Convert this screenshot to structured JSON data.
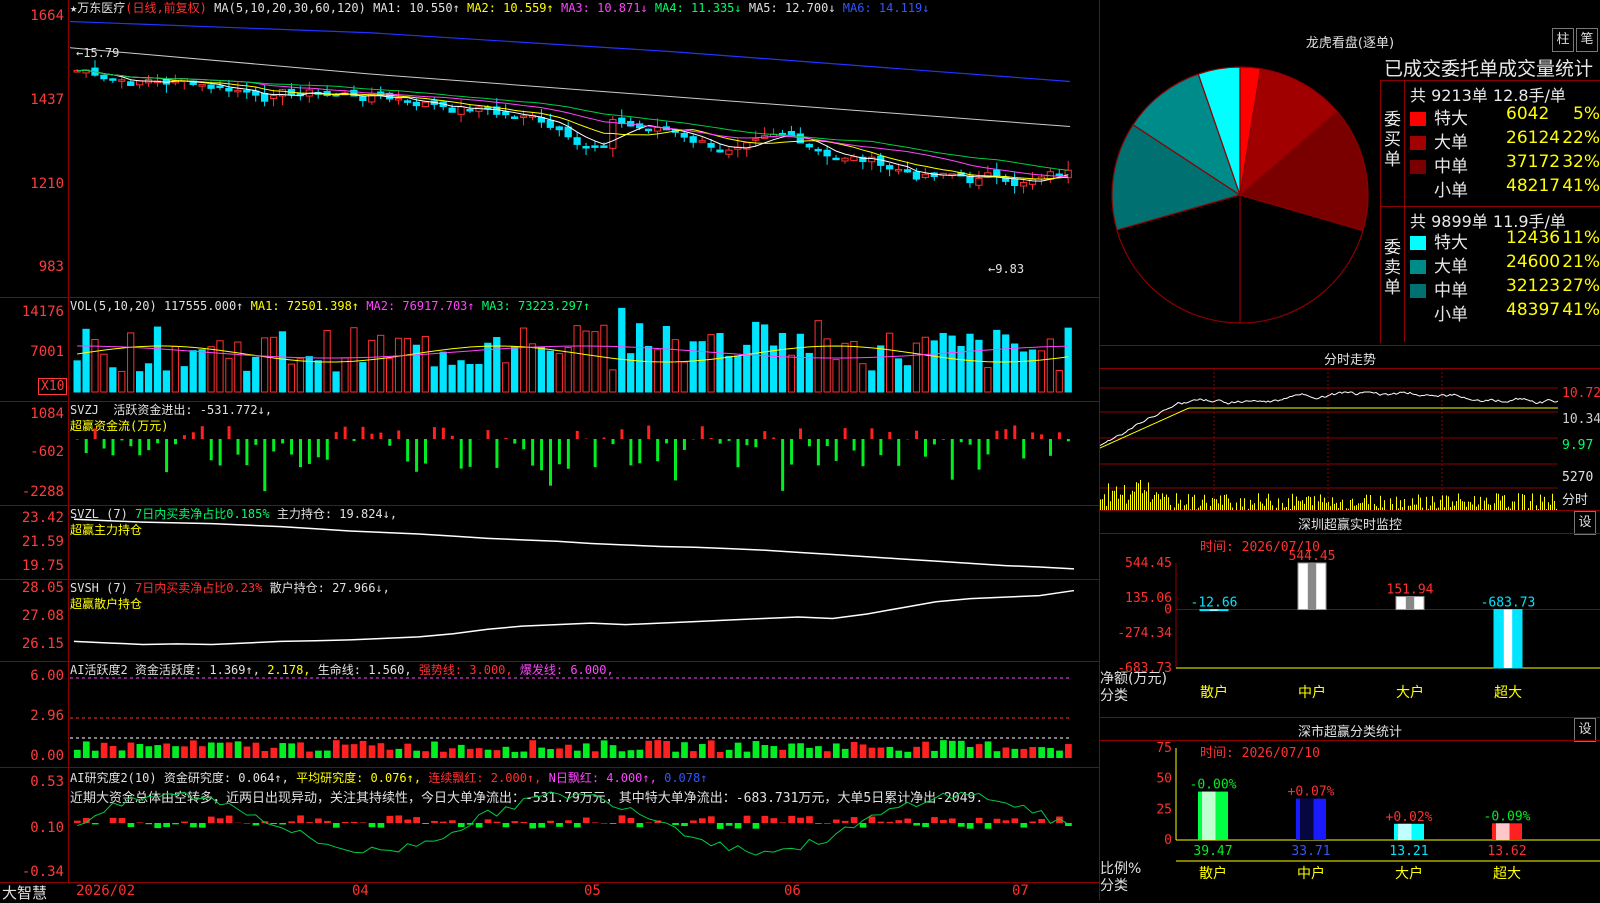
{
  "stock": {
    "name": "★万东医疗",
    "period": "(日线,前复权)"
  },
  "ma_legend": {
    "label": "MA(5,10,20,30,60,120)",
    "ma1": "MA1: 10.550↑",
    "ma2": "MA2: 10.559↑",
    "ma3": "MA3: 10.871↓",
    "ma4": "MA4: 11.335↓",
    "ma5": "MA5: 12.700↓",
    "ma6": "MA6: 14.119↓"
  },
  "price_axis": [
    "1664",
    "1437",
    "1210",
    "983"
  ],
  "price_annotations": {
    "high": "15.79",
    "low": "9.83"
  },
  "vol_panel": {
    "label": "VOL(5,10,20)",
    "value": "117555.000↑",
    "ma1": "MA1: 72501.398↑",
    "ma2": "MA2: 76917.703↑",
    "ma3": "MA3: 73223.297↑",
    "axis": [
      "14176",
      "7001"
    ],
    "unit": "X10"
  },
  "svzj_panel": {
    "label": "SVZJ",
    "line1": "活跃资金进出: -531.772↓,",
    "line2": "超赢资金流(万元)",
    "axis": [
      "1084",
      "-602",
      "-2288"
    ]
  },
  "svzl_panel": {
    "label": "SVZL (7)",
    "text_a": "7日内买卖净占比0.185%",
    "text_b": "主力持仓: 19.824↓,",
    "line2": "超赢主力持仓",
    "axis": [
      "23.42",
      "21.59",
      "19.75"
    ]
  },
  "svsh_panel": {
    "label": "SVSH (7)",
    "text_a": "7日内买卖净占比0.23%",
    "text_b": "散户持仓: 27.966↓,",
    "line2": "超赢散户持仓",
    "axis": [
      "28.05",
      "27.08",
      "26.15"
    ]
  },
  "ai_active": {
    "label": "AI活跃度2",
    "t1": "资金活跃度: 1.369↑,",
    "t2": "2.178,",
    "t3": "生命线: 1.560,",
    "t4": "强势线: 3.000,",
    "t5": "爆发线: 6.000,",
    "axis": [
      "6.00",
      "2.96",
      "0.00"
    ]
  },
  "ai_research": {
    "label": "AI研究度2(10)",
    "t1": "资金研究度: 0.064↑,",
    "t2": "平均研究度: 0.076↑,",
    "t3": "连续飘红: 2.000↑,",
    "t4": "N日飘红: 4.000↑,",
    "t5": "0.078↑",
    "comment": "近期大资金总体由空转多，近两日出现异动，关注其持续性，今日大单净流出：-531.79万元，其中特大单净流出：-683.731万元，大单5日累计净出-2049.",
    "axis": [
      "0.53",
      "0.10",
      "-0.34"
    ]
  },
  "time_axis": [
    "2026/02",
    "04",
    "05",
    "06",
    "07"
  ],
  "brand": "大智慧",
  "dragon": {
    "title": "龙虎看盘(逐单)",
    "btn1": "柱",
    "btn2": "笔",
    "stats_title": "已成交委托单成交量统计",
    "buy_header": "共 9213单 12.8手/单",
    "buy_side": "委买单",
    "buy_rows": [
      {
        "name": "特大",
        "vol": "6042",
        "pct": "5%",
        "color": "#ff0000"
      },
      {
        "name": "大单",
        "vol": "26124",
        "pct": "22%",
        "color": "#a00000"
      },
      {
        "name": "中单",
        "vol": "37172",
        "pct": "32%",
        "color": "#7a0000"
      },
      {
        "name": "小单",
        "vol": "48217",
        "pct": "41%",
        "color": "#000000"
      }
    ],
    "sell_header": "共 9899单 11.9手/单",
    "sell_side": "委卖单",
    "sell_rows": [
      {
        "name": "特大",
        "vol": "12436",
        "pct": "11%",
        "color": "#00ffff"
      },
      {
        "name": "大单",
        "vol": "24600",
        "pct": "21%",
        "color": "#008b8b"
      },
      {
        "name": "中单",
        "vol": "32123",
        "pct": "27%",
        "color": "#007070"
      },
      {
        "name": "小单",
        "vol": "48397",
        "pct": "41%",
        "color": "#000000"
      }
    ]
  },
  "intraday": {
    "title": "分时走势",
    "axis": [
      "10.72",
      "10.34",
      "9.97",
      "5270",
      "分时"
    ]
  },
  "monitor": {
    "title": "深圳超赢实时监控",
    "btn": "设",
    "time": "时间: 2026/07/10",
    "axis": [
      "544.45",
      "135.06",
      "0",
      "-274.34",
      "-683.73"
    ],
    "ylabel1": "净额(万元)",
    "ylabel2": "分类"
  },
  "classify": {
    "title": "深市超赢分类统计",
    "btn": "设",
    "time": "时间: 2026/07/10",
    "axis": [
      "75",
      "50",
      "25",
      "0"
    ],
    "ylabel1": "比例%",
    "ylabel2": "分类"
  },
  "chart_data": [
    {
      "type": "pie",
      "title": "龙虎看盘(逐单)",
      "categories": [
        "委买单 特大",
        "委买单 大单",
        "委买单 中单",
        "委买单 小单",
        "委卖单 小单",
        "委卖单 中单",
        "委卖单 大单",
        "委卖单 特大"
      ],
      "values": [
        6042,
        26124,
        37172,
        48217,
        48397,
        32123,
        24600,
        12436
      ],
      "colors": [
        "#ff0000",
        "#a00000",
        "#7a0000",
        "#000000",
        "#000000",
        "#007070",
        "#008b8b",
        "#00ffff"
      ]
    },
    {
      "type": "bar",
      "title": "深圳超赢实时监控",
      "categories": [
        "散户",
        "中户",
        "大户",
        "超大"
      ],
      "values": [
        -12.66,
        544.45,
        151.94,
        -683.73
      ],
      "value_labels": [
        "-12.66",
        "544.45",
        "151.94",
        "-683.73"
      ],
      "ylabel": "净额(万元)",
      "xlabel": "分类",
      "ylim": [
        -683.73,
        544.45
      ]
    },
    {
      "type": "bar",
      "title": "深市超赢分类统计",
      "categories": [
        "散户",
        "中户",
        "大户",
        "超大"
      ],
      "values": [
        39.47,
        33.71,
        13.21,
        13.62
      ],
      "change_labels": [
        "-0.00%",
        "+0.07%",
        "+0.02%",
        "-0.09%"
      ],
      "bar_colors": [
        "#00ff44",
        "#1a1aff",
        "#00ffff",
        "#ff2020"
      ],
      "ylabel": "比例%",
      "xlabel": "分类",
      "ylim": [
        0,
        75
      ]
    },
    {
      "type": "line",
      "title": "超赢主力持仓",
      "ylim": [
        19.75,
        23.42
      ],
      "values": [
        23.2,
        23.1,
        23.0,
        22.95,
        22.9,
        22.8,
        22.7,
        22.55,
        22.4,
        22.3,
        22.2,
        22.05,
        21.9,
        21.8,
        21.7,
        21.55,
        21.45,
        21.35,
        21.3,
        21.2,
        21.1,
        20.95,
        20.8,
        20.65,
        20.5,
        20.35,
        20.2,
        20.05,
        19.95,
        19.824
      ]
    },
    {
      "type": "line",
      "title": "超赢散户持仓",
      "ylim": [
        26.15,
        28.05
      ],
      "values": [
        26.3,
        26.25,
        26.2,
        26.22,
        26.2,
        26.25,
        26.3,
        26.32,
        26.35,
        26.4,
        26.45,
        26.55,
        26.7,
        26.8,
        26.85,
        26.9,
        26.85,
        26.9,
        26.95,
        27.0,
        27.05,
        27.1,
        27.05,
        27.2,
        27.4,
        27.6,
        27.7,
        27.75,
        27.8,
        27.966
      ]
    }
  ]
}
